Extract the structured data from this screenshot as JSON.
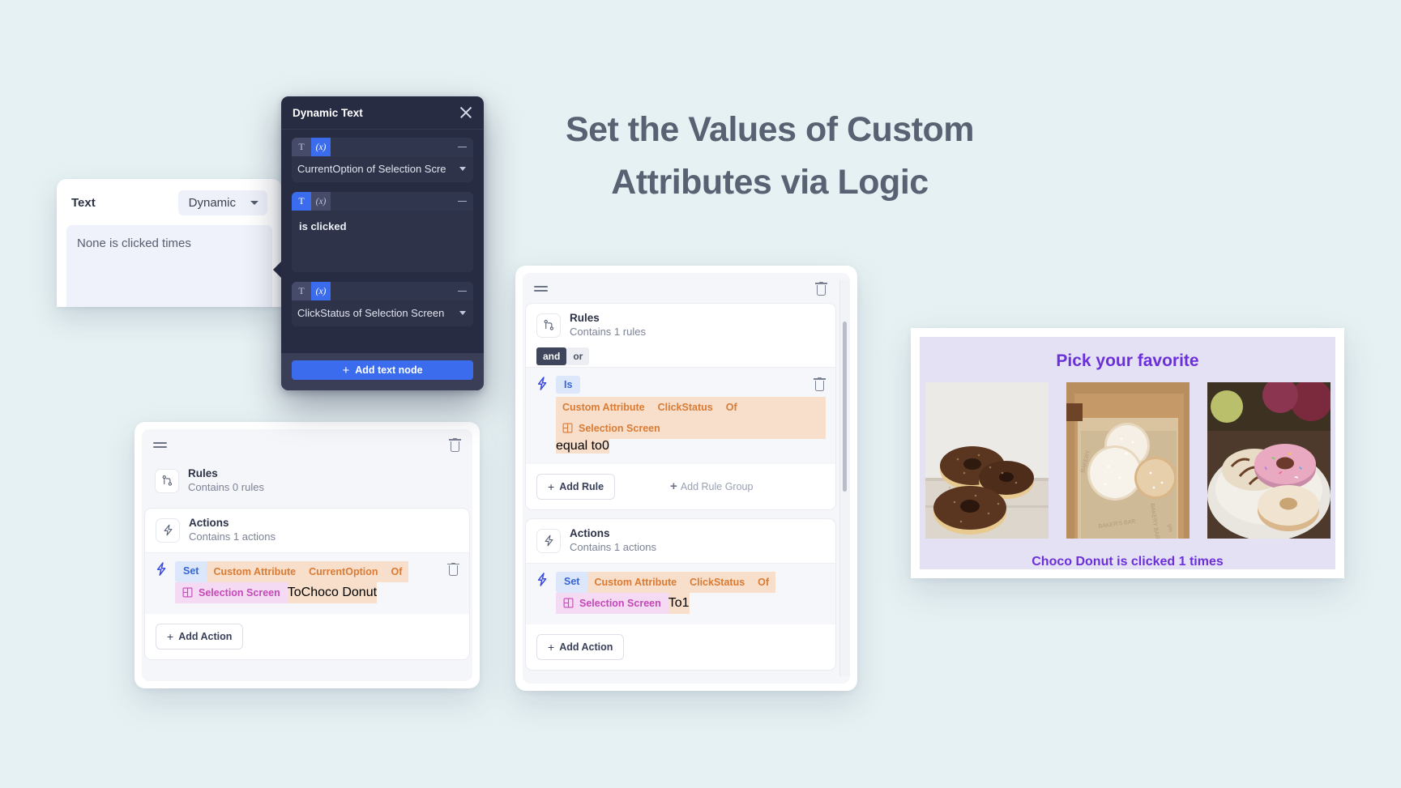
{
  "headline": "Set the Values of Custom Attributes via Logic",
  "colors": {
    "background": "#e6f1f3",
    "headline_text": "#596273",
    "accent_blue": "#3b6ced",
    "orange_chip_bg": "#f7dfcb",
    "orange_chip_text": "#d97b34",
    "pink_chip_bg": "#f4dbf3",
    "pink_chip_text": "#c448b7",
    "blue_chip_bg": "#dde7fb",
    "blue_chip_text": "#3464d6",
    "purple_text": "#6b30d9",
    "preview_bg": "#e4e1f5"
  },
  "text_panel": {
    "label": "Text",
    "mode_select": "Dynamic",
    "preview_value": "None is clicked times"
  },
  "dynamic_text_dialog": {
    "title": "Dynamic Text",
    "close_label": "×",
    "nodes": [
      {
        "type_toggle": "expression",
        "t_glyph": "T",
        "x_glyph": "(x)",
        "value": "CurrentOption of Selection Scre",
        "kind": "select"
      },
      {
        "type_toggle": "text",
        "t_glyph": "T",
        "x_glyph": "(x)",
        "value": "is clicked",
        "kind": "textarea"
      },
      {
        "type_toggle": "expression",
        "t_glyph": "T",
        "x_glyph": "(x)",
        "value": "ClickStatus of Selection Screen",
        "kind": "select"
      }
    ],
    "add_button": "Add text node",
    "add_button_plus": "+"
  },
  "left_card": {
    "rules": {
      "title": "Rules",
      "subtitle": "Contains 0 rules"
    },
    "actions": {
      "title": "Actions",
      "subtitle": "Contains 1 actions",
      "items": [
        {
          "verb": "Set",
          "attribute_label": "Custom Attribute",
          "attribute_name": "CurrentOption",
          "of": "Of",
          "screen": "Selection Screen",
          "to": "To",
          "value": "Choco Donut"
        }
      ],
      "add_button": "Add Action",
      "add_button_plus": "+"
    }
  },
  "center_card": {
    "rules": {
      "title": "Rules",
      "subtitle": "Contains 1 rules",
      "operator_and": "and",
      "operator_or": "or",
      "active_operator": "and",
      "conditions": [
        {
          "verb": "Is",
          "attribute_label": "Custom Attribute",
          "attribute_name": "ClickStatus",
          "of": "Of",
          "screen": "Selection Screen",
          "comparator": "equal to",
          "value": "0"
        }
      ],
      "add_rule_button": "Add Rule",
      "add_rule_group_button": "Add Rule Group",
      "plus": "+"
    },
    "actions": {
      "title": "Actions",
      "subtitle": "Contains 1 actions",
      "items": [
        {
          "verb": "Set",
          "attribute_label": "Custom Attribute",
          "attribute_name": "ClickStatus",
          "of": "Of",
          "screen": "Selection Screen",
          "to": "To",
          "value": "1"
        }
      ],
      "add_button": "Add Action",
      "add_button_plus": "+"
    }
  },
  "donut_preview": {
    "title": "Pick your favorite",
    "caption": "Choco Donut is clicked 1 times",
    "options": [
      {
        "name": "choco-donut"
      },
      {
        "name": "sugar-donut"
      },
      {
        "name": "pink-donut"
      }
    ]
  }
}
